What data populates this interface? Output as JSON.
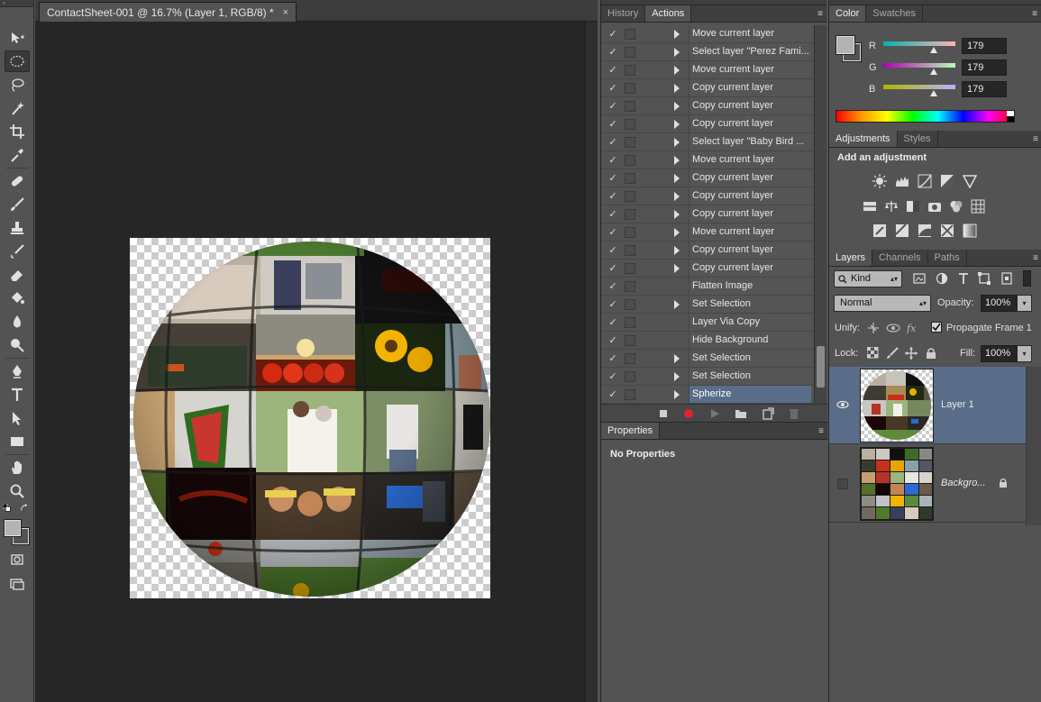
{
  "document": {
    "tab_title": "ContactSheet-001 @ 16.7% (Layer 1, RGB/8) *",
    "close_glyph": "×"
  },
  "tools": [
    "move-tool",
    "marquee-tool",
    "lasso-tool",
    "magic-wand-tool",
    "crop-tool",
    "eyedropper-tool",
    "healing-brush-tool",
    "brush-tool",
    "clone-stamp-tool",
    "history-brush-tool",
    "eraser-tool",
    "paint-bucket-tool",
    "blur-tool",
    "dodge-tool",
    "pen-tool",
    "type-tool",
    "path-selection-tool",
    "rectangle-tool",
    "hand-tool",
    "zoom-tool"
  ],
  "actions_panel": {
    "tabs": [
      "History",
      "Actions"
    ],
    "active_tab": "Actions",
    "menu_glyph": "≡",
    "items": [
      {
        "label": "Move current layer",
        "expandable": true,
        "selected": false
      },
      {
        "label": "Select layer \"Perez Fami...",
        "expandable": true,
        "selected": false
      },
      {
        "label": "Move current layer",
        "expandable": true,
        "selected": false
      },
      {
        "label": "Copy current layer",
        "expandable": true,
        "selected": false
      },
      {
        "label": "Copy current layer",
        "expandable": true,
        "selected": false
      },
      {
        "label": "Copy current layer",
        "expandable": true,
        "selected": false
      },
      {
        "label": "Select layer \"Baby Bird ...",
        "expandable": true,
        "selected": false
      },
      {
        "label": "Move current layer",
        "expandable": true,
        "selected": false
      },
      {
        "label": "Copy current layer",
        "expandable": true,
        "selected": false
      },
      {
        "label": "Copy current layer",
        "expandable": true,
        "selected": false
      },
      {
        "label": "Copy current layer",
        "expandable": true,
        "selected": false
      },
      {
        "label": "Move current layer",
        "expandable": true,
        "selected": false
      },
      {
        "label": "Copy current layer",
        "expandable": true,
        "selected": false
      },
      {
        "label": "Copy current layer",
        "expandable": true,
        "selected": false
      },
      {
        "label": "Flatten Image",
        "expandable": false,
        "selected": false
      },
      {
        "label": "Set Selection",
        "expandable": true,
        "selected": false
      },
      {
        "label": "Layer Via Copy",
        "expandable": false,
        "selected": false
      },
      {
        "label": "Hide Background",
        "expandable": false,
        "selected": false
      },
      {
        "label": "Set Selection",
        "expandable": true,
        "selected": false
      },
      {
        "label": "Set Selection",
        "expandable": true,
        "selected": false
      },
      {
        "label": "Spherize",
        "expandable": true,
        "selected": true
      }
    ],
    "check_glyph": "✓",
    "footer_buttons": [
      "stop-button",
      "record-button",
      "play-button",
      "new-set-button",
      "new-action-button",
      "delete-button"
    ]
  },
  "properties_panel": {
    "tab": "Properties",
    "content": "No Properties"
  },
  "color_panel": {
    "tabs": [
      "Color",
      "Swatches"
    ],
    "active_tab": "Color",
    "channels": [
      {
        "name": "R",
        "value": "179"
      },
      {
        "name": "G",
        "value": "179"
      },
      {
        "name": "B",
        "value": "179"
      }
    ],
    "foreground": "#b3b3b3"
  },
  "adjustments_panel": {
    "tabs": [
      "Adjustments",
      "Styles"
    ],
    "active_tab": "Adjustments",
    "heading": "Add an adjustment"
  },
  "layers_panel": {
    "tabs": [
      "Layers",
      "Channels",
      "Paths"
    ],
    "active_tab": "Layers",
    "filter_label": "Kind",
    "blend_mode": "Normal",
    "opacity_label": "Opacity:",
    "opacity": "100%",
    "unify_label": "Unify:",
    "propagate_label": "Propagate Frame 1",
    "lock_label": "Lock:",
    "fill_label": "Fill:",
    "fill": "100%",
    "layers": [
      {
        "name": "Layer 1",
        "visible": true,
        "selected": true,
        "locked": false
      },
      {
        "name": "Backgro...",
        "visible": false,
        "selected": false,
        "locked": true
      }
    ]
  },
  "colors": {
    "selection": "#596d89",
    "panel": "#535353",
    "document_bg": "#262626",
    "record": "#e0242b"
  }
}
